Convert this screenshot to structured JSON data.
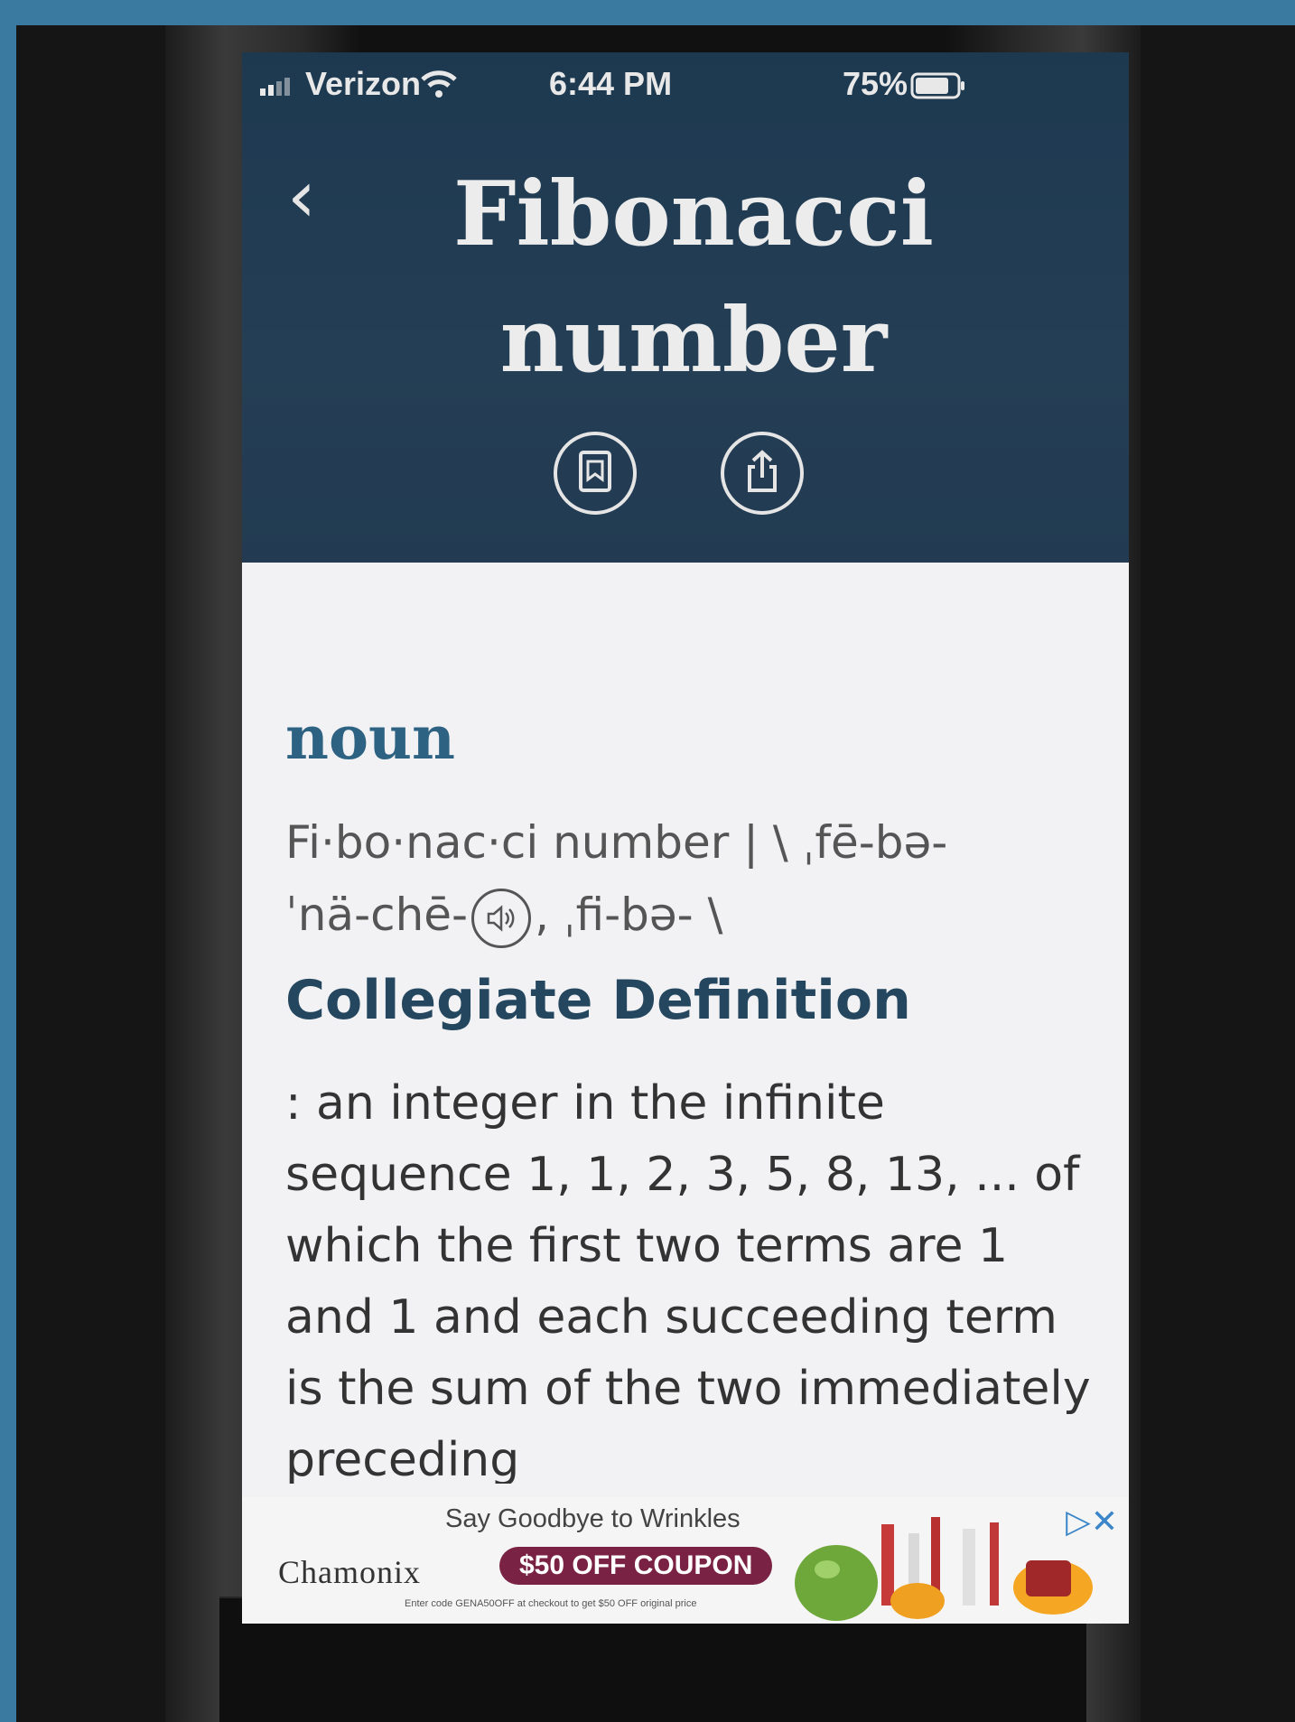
{
  "status_bar": {
    "carrier": "Verizon",
    "time": "6:44 PM",
    "battery": "75%"
  },
  "header": {
    "title_line1": "Fibonacci",
    "title_line2": "number"
  },
  "entry": {
    "part_of_speech": "noun",
    "pron_line1": "Fi·bo·nac·ci number  |  \\ ˌfē-bə-",
    "pron_line2_a": "ˈnä-chē-",
    "pron_line2_b": ", ˌfi-bə- \\",
    "definition_title": "Collegiate Definition",
    "definition_text": ": an integer in the infinite sequence 1, 1, 2, 3, 5, 8, 13,  ... of which the first two terms are 1 and 1 and each succeeding term is the sum of the two immediately preceding"
  },
  "ad": {
    "brand": "Chamonix",
    "headline": "Say Goodbye to Wrinkles",
    "coupon": "$50 OFF COUPON",
    "fine_print": "Enter code GENA50OFF at checkout to get $50 OFF original price"
  },
  "colors": {
    "header_bg": "#1d3950",
    "accent_pos": "#2e6282",
    "coupon_bg": "#7a2244"
  }
}
